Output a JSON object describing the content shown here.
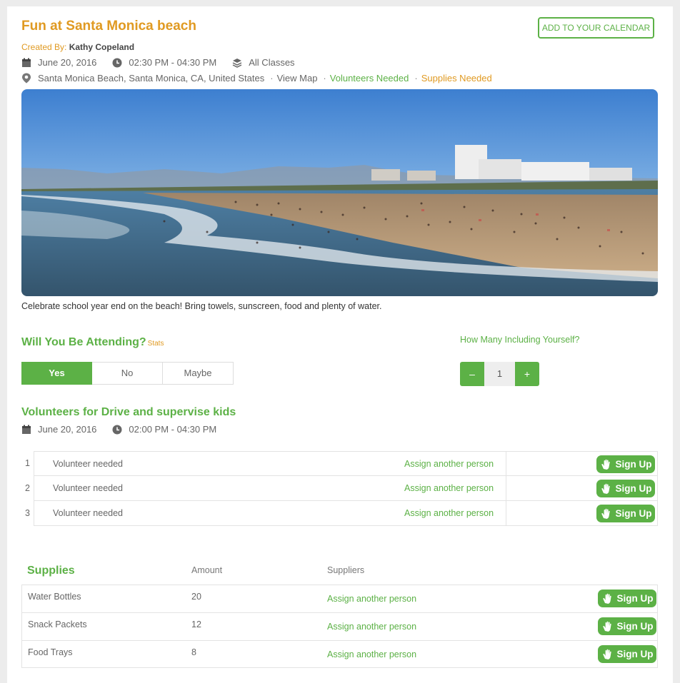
{
  "event": {
    "title": "Fun at Santa Monica beach",
    "add_calendar": "ADD TO YOUR CALENDAR",
    "created_by_label": "Created By:",
    "created_by_name": "Kathy Copeland",
    "date": "June 20, 2016",
    "time": "02:30 PM - 04:30 PM",
    "classes": "All Classes",
    "location": "Santa Monica Beach, Santa Monica, CA, United States",
    "view_map": "View Map",
    "volunteers_needed": "Volunteers Needed",
    "supplies_needed": "Supplies Needed",
    "description": "Celebrate school year end on the beach! Bring towels, sunscreen, food and plenty of water."
  },
  "attendance": {
    "heading": "Will You Be Attending?",
    "stats_label": "Stats",
    "options": [
      "Yes",
      "No",
      "Maybe"
    ],
    "selected": "Yes",
    "how_many_label": "How Many Including Yourself?",
    "count": "1",
    "minus": "–",
    "plus": "+"
  },
  "volunteers": {
    "heading": "Volunteers for Drive and supervise kids",
    "date": "June 20, 2016",
    "time": "02:00 PM - 04:30 PM",
    "rows": [
      {
        "num": "1",
        "name": "Volunteer needed",
        "assign": "Assign another person",
        "signup": "Sign Up"
      },
      {
        "num": "2",
        "name": "Volunteer needed",
        "assign": "Assign another person",
        "signup": "Sign Up"
      },
      {
        "num": "3",
        "name": "Volunteer needed",
        "assign": "Assign another person",
        "signup": "Sign Up"
      }
    ]
  },
  "supplies": {
    "heading": "Supplies",
    "col_amount": "Amount",
    "col_suppliers": "Suppliers",
    "rows": [
      {
        "item": "Water Bottles",
        "amount": "20",
        "assign": "Assign another person",
        "signup": "Sign Up"
      },
      {
        "item": "Snack Packets",
        "amount": "12",
        "assign": "Assign another person",
        "signup": "Sign Up"
      },
      {
        "item": "Food Trays",
        "amount": "8",
        "assign": "Assign another person",
        "signup": "Sign Up"
      }
    ]
  },
  "colors": {
    "accent_green": "#5cb146",
    "accent_orange": "#e09a22"
  },
  "icons": [
    "calendar-icon",
    "clock-icon",
    "layers-icon",
    "location-pin-icon",
    "hand-icon"
  ]
}
